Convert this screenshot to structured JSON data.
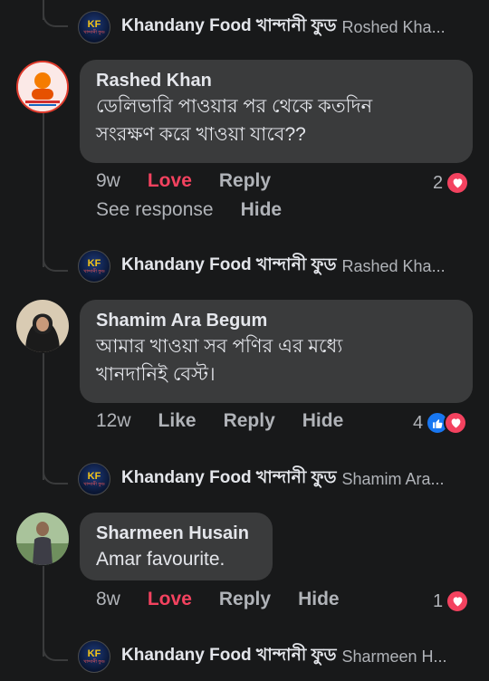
{
  "page_name": "Khandany Food খান্দানী ফুড",
  "comments": [
    {
      "reply_preview": "Roshed Kha...",
      "author": "Rashed Khan",
      "text_line1": "ডেলিভারি পাওয়ার পর থেকে কতদিন",
      "text_line2": "সংরক্ষণ করে খাওয়া যাবে??",
      "time": "9w",
      "reaction_label": "Love",
      "reply_label": "Reply",
      "reaction_count": "2",
      "see_response": "See response",
      "hide_label": "Hide"
    },
    {
      "reply_preview": "Rashed Kha...",
      "author": "Shamim Ara Begum",
      "text_line1": "আমার খাওয়া সব পণির এর মধ্যে",
      "text_line2": "খানদানিই বেস্ট।",
      "time": "12w",
      "reaction_label": "Like",
      "reply_label": "Reply",
      "hide_label": "Hide",
      "reaction_count": "4"
    },
    {
      "reply_preview": "Shamim Ara...",
      "author": "Sharmeen Husain",
      "text_line1": "Amar favourite.",
      "time": "8w",
      "reaction_label": "Love",
      "reply_label": "Reply",
      "hide_label": "Hide",
      "reaction_count": "1"
    }
  ],
  "last_reply_preview": "Sharmeen H...",
  "page_avatar": {
    "logo_letters": "KF",
    "logo_sub": "খান্দানী ফুড"
  },
  "colors": {
    "background": "#18191a",
    "bubble": "#3a3b3c",
    "love": "#f3425f",
    "like": "#1877f2",
    "muted": "#b0b3b8"
  },
  "icons": {
    "love": "heart-icon",
    "like": "thumbs-up-icon"
  }
}
